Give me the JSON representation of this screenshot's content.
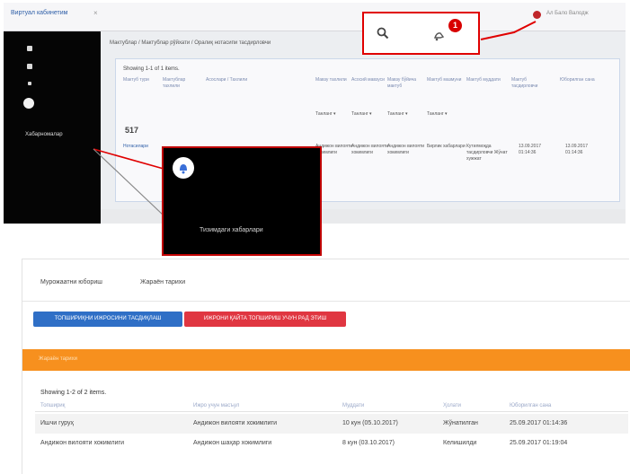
{
  "top_screenshot": {
    "app_tab": "Виртуал кабинетим",
    "app_tab_close": "×",
    "user_name": "Ал Бало Валодж",
    "breadcrumb": "Мактублар / Мактублар рўйхати / Оралиқ нотасипи тасдирловчи",
    "box_heading": "Showing 1-1 of 1 items.",
    "columns": [
      "Мактуб тури",
      "Мактублар тахлили",
      "Асослари / Тахлили",
      "Мавзу тахлили",
      "Асосий мавзуси",
      "Мавзу бўйича мактуб",
      "Мактуб мазмуни",
      "Мактуб муддати",
      "Мактуб тасдирловчи",
      "Юборилган сана"
    ],
    "filters": [
      "Танланг",
      "Танланг",
      "Танланг",
      "Танланг"
    ],
    "filter_arrow": "▾",
    "count": "517",
    "row": [
      "Нотасилари",
      "Андижон вилояти хокимлиги",
      "Андижон вилояти хокимлиги",
      "Андижон вилояти хокимлиги",
      "Бирлик хабарлари",
      "Кутилмоқда тасдирловчи Жўнат хужжат",
      "13.09.2017 01:14:36",
      "13.09.2017 01:14:36"
    ],
    "sidebar_label": "Хабарномалар",
    "notification_badge": "1",
    "menu_callout_label": "Тизимдаги хабарлари",
    "accent_red": "#e00000",
    "sidebar_dark": "#050505"
  },
  "bottom_screenshot": {
    "nav": [
      "Мурожаатни юбориш",
      "Жараён тарихи"
    ],
    "buttons": [
      "ТОПШИРИҚНИ ИЖРОСИНИ ТАСДИҚЛАШ",
      "ИЖРОНИ ҚАЙТА ТОПШИРИШ УЧУН РАД ЭТИШ"
    ],
    "orange_label": "Жараён тарихи",
    "showing": "Showing 1-2 of 2 items.",
    "columns": [
      "Топшириқ",
      "Ижро учун масъул",
      "Муддати",
      "Ҳолати",
      "Юборилган сана"
    ],
    "rows": [
      [
        "Ишчи гуруҳ",
        "Андижон вилояти хокимлиги",
        "10 кун (05.10.2017)",
        "Жўнатилган",
        "25.09.2017 01:14:36"
      ],
      [
        "Андижон вилояти хокимлиги",
        "Андижон шаҳар хокимлиги",
        "8 кун (03.10.2017)",
        "Келишилди",
        "25.09.2017 01:19:04"
      ]
    ],
    "primary_blue": "#2f6fc6",
    "danger_red": "#e03641",
    "orange": "#f7901e"
  }
}
